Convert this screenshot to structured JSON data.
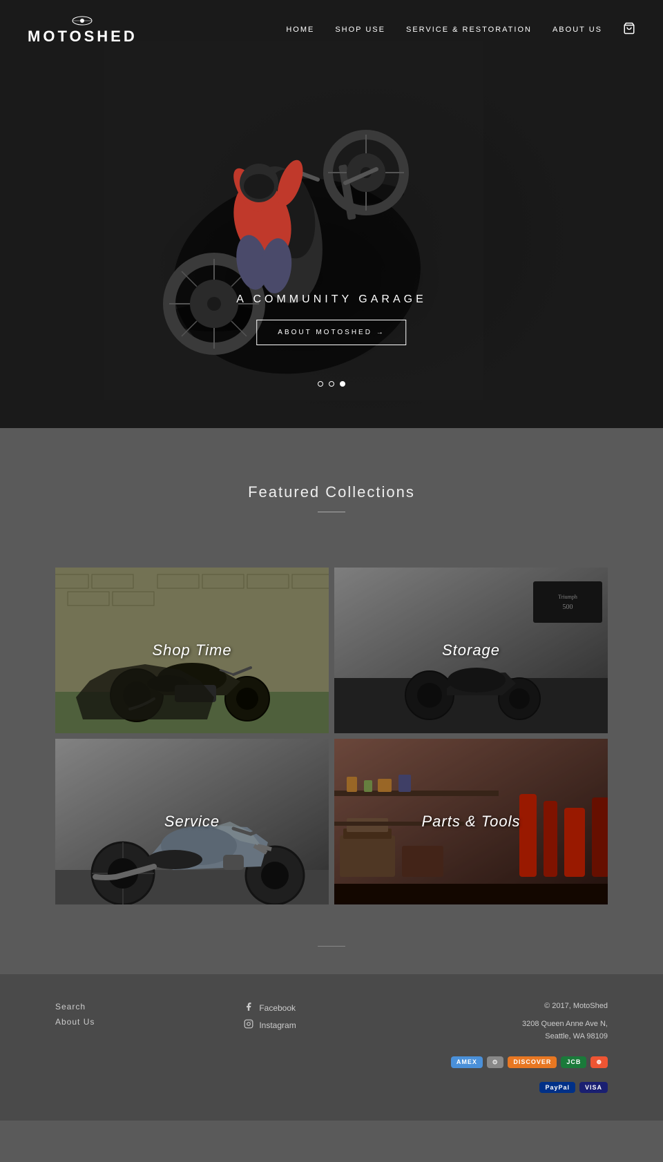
{
  "header": {
    "logo_text": "MOTOSHED",
    "logo_icon": "🏍",
    "nav": [
      {
        "label": "HOME",
        "href": "#"
      },
      {
        "label": "SHOP USE",
        "href": "#"
      },
      {
        "label": "SERVICE & RESTORATION",
        "href": "#"
      },
      {
        "label": "ABOUT US",
        "href": "#"
      }
    ],
    "cart_icon": "🛒"
  },
  "hero": {
    "title": "A COMMUNITY GARAGE",
    "button_label": "ABOUT MOTOSHED →",
    "dots": [
      {
        "active": false
      },
      {
        "active": false
      },
      {
        "active": true
      }
    ]
  },
  "featured": {
    "title": "Featured Collections",
    "collections": [
      {
        "label": "Shop Time",
        "id": "shop-time"
      },
      {
        "label": "Storage",
        "id": "storage"
      },
      {
        "label": "Service",
        "id": "service"
      },
      {
        "label": "Parts & Tools",
        "id": "parts-tools"
      }
    ]
  },
  "footer": {
    "links": [
      {
        "label": "Search"
      },
      {
        "label": "About Us"
      }
    ],
    "social": [
      {
        "platform": "Facebook",
        "icon": "f"
      },
      {
        "platform": "Instagram",
        "icon": "📷"
      }
    ],
    "copyright": "© 2017, MotoShed",
    "address": "3208 Queen Anne Ave N,\nSeattle, WA 98109",
    "payment_methods": [
      "AMEX",
      "DINERS",
      "DISCOVER",
      "JCB",
      "MASTER",
      "PAYPAL",
      "VISA"
    ]
  }
}
